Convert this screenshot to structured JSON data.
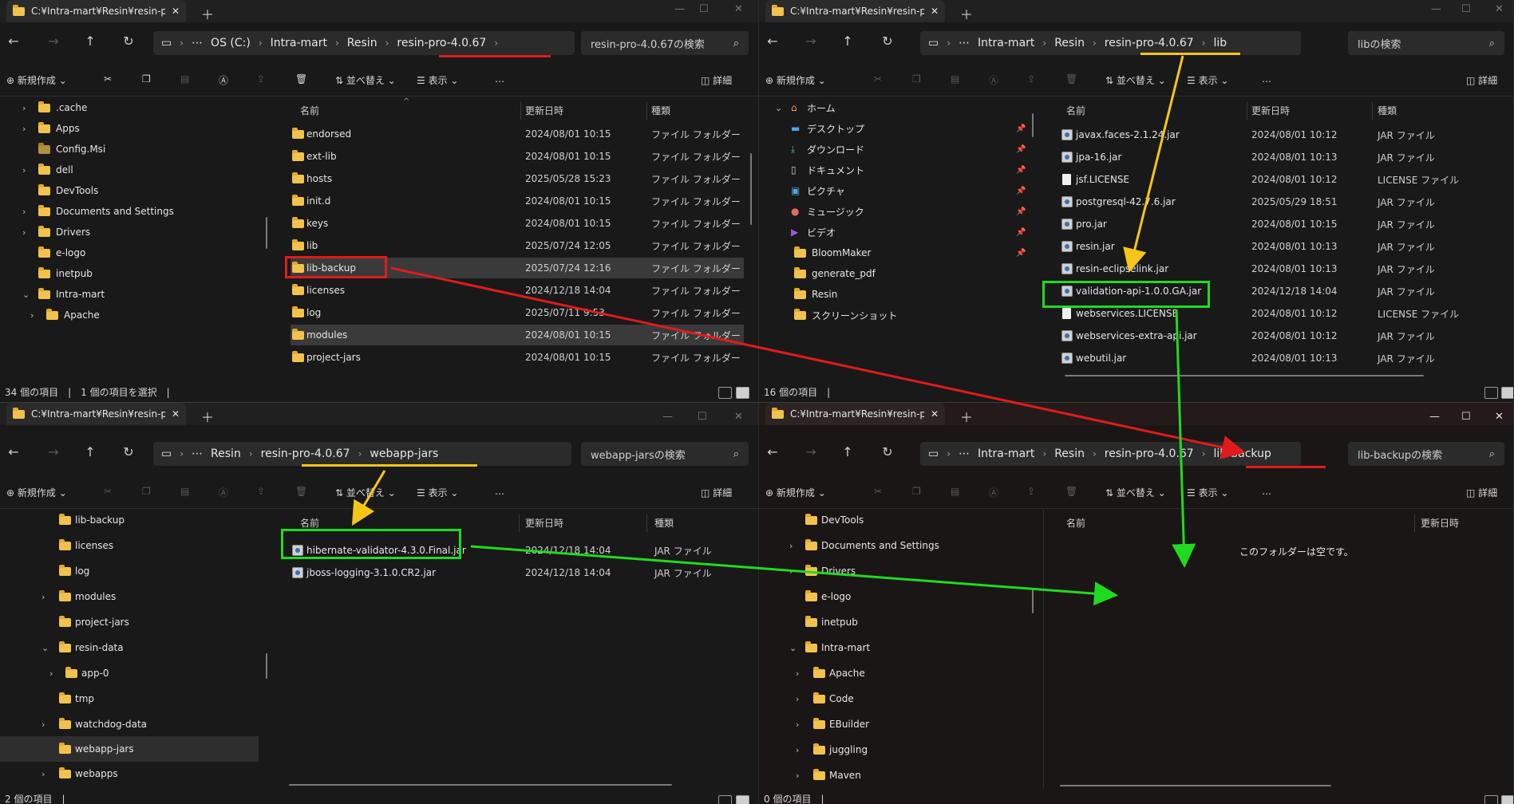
{
  "colors": {
    "red": "#e11b1b",
    "yellow": "#f5c518",
    "green": "#1fdb1f",
    "folder": "#f2c24f"
  },
  "toolbar": {
    "new_label": "新規作成",
    "sort_label": "並べ替え",
    "view_label": "表示",
    "more_label": "…",
    "details_label": "詳細"
  },
  "columns": {
    "name": "名前",
    "date": "更新日時",
    "type": "種類"
  },
  "w0": {
    "tab_title": "C:¥Intra-mart¥Resin¥resin-pro",
    "breadcrumb": [
      "OS (C:)",
      "Intra-mart",
      "Resin",
      "resin-pro-4.0.67"
    ],
    "search": "resin-pro-4.0.67の検索",
    "sidebar": [
      ".cache",
      "Apps",
      "Config.Msi",
      "dell",
      "DevTools",
      "Documents and Settings",
      "Drivers",
      "e-logo",
      "inetpub",
      "Intra-mart",
      "Apache"
    ],
    "files": [
      {
        "name": "endorsed",
        "date": "2024/08/01 10:15",
        "type": "ファイル フォルダー"
      },
      {
        "name": "ext-lib",
        "date": "2024/08/01 10:15",
        "type": "ファイル フォルダー"
      },
      {
        "name": "hosts",
        "date": "2025/05/28 15:23",
        "type": "ファイル フォルダー"
      },
      {
        "name": "init.d",
        "date": "2024/08/01 10:15",
        "type": "ファイル フォルダー"
      },
      {
        "name": "keys",
        "date": "2024/08/01 10:15",
        "type": "ファイル フォルダー"
      },
      {
        "name": "lib",
        "date": "2025/07/24 12:05",
        "type": "ファイル フォルダー"
      },
      {
        "name": "lib-backup",
        "date": "2025/07/24 12:16",
        "type": "ファイル フォルダー"
      },
      {
        "name": "licenses",
        "date": "2024/12/18 14:04",
        "type": "ファイル フォルダー"
      },
      {
        "name": "log",
        "date": "2025/07/11 9:53",
        "type": "ファイル フォルダー"
      },
      {
        "name": "modules",
        "date": "2024/08/01 10:15",
        "type": "ファイル フォルダー"
      },
      {
        "name": "project-jars",
        "date": "2024/08/01 10:15",
        "type": "ファイル フォルダー"
      }
    ],
    "status": "34 個の項目　|　1 個の項目を選択　|"
  },
  "w1": {
    "tab_title": "C:¥Intra-mart¥Resin¥resin-pro",
    "breadcrumb": [
      "Intra-mart",
      "Resin",
      "resin-pro-4.0.67",
      "lib"
    ],
    "search": "libの検索",
    "sidebar": [
      "ホーム",
      "デスクトップ",
      "ダウンロード",
      "ドキュメント",
      "ピクチャ",
      "ミュージック",
      "ビデオ",
      "BloomMaker",
      "generate_pdf",
      "Resin",
      "スクリーンショット"
    ],
    "files": [
      {
        "name": "javax.faces-2.1.24.jar",
        "date": "2024/08/01 10:12",
        "type": "JAR ファイル"
      },
      {
        "name": "jpa-16.jar",
        "date": "2024/08/01 10:13",
        "type": "JAR ファイル"
      },
      {
        "name": "jsf.LICENSE",
        "date": "2024/08/01 10:12",
        "type": "LICENSE ファイル"
      },
      {
        "name": "postgresql-42.7.6.jar",
        "date": "2025/05/29 18:51",
        "type": "JAR ファイル"
      },
      {
        "name": "pro.jar",
        "date": "2024/08/01 10:15",
        "type": "JAR ファイル"
      },
      {
        "name": "resin.jar",
        "date": "2024/08/01 10:13",
        "type": "JAR ファイル"
      },
      {
        "name": "resin-eclipselink.jar",
        "date": "2024/08/01 10:13",
        "type": "JAR ファイル"
      },
      {
        "name": "validation-api-1.0.0.GA.jar",
        "date": "2024/12/18 14:04",
        "type": "JAR ファイル"
      },
      {
        "name": "webservices.LICENSE",
        "date": "2024/08/01 10:12",
        "type": "LICENSE ファイル"
      },
      {
        "name": "webservices-extra-api.jar",
        "date": "2024/08/01 10:12",
        "type": "JAR ファイル"
      },
      {
        "name": "webutil.jar",
        "date": "2024/08/01 10:13",
        "type": "JAR ファイル"
      }
    ],
    "status": "16 個の項目　|"
  },
  "w2": {
    "tab_title": "C:¥Intra-mart¥Resin¥resin-pro",
    "breadcrumb": [
      "Resin",
      "resin-pro-4.0.67",
      "webapp-jars"
    ],
    "search": "webapp-jarsの検索",
    "sidebar": [
      "lib-backup",
      "licenses",
      "log",
      "modules",
      "project-jars",
      "resin-data",
      "app-0",
      "tmp",
      "watchdog-data",
      "webapp-jars",
      "webapps"
    ],
    "files": [
      {
        "name": "hibernate-validator-4.3.0.Final.jar",
        "date": "2024/12/18 14:04",
        "type": "JAR ファイル"
      },
      {
        "name": "jboss-logging-3.1.0.CR2.jar",
        "date": "2024/12/18 14:04",
        "type": "JAR ファイル"
      }
    ],
    "status": "2 個の項目　|"
  },
  "w3": {
    "tab_title": "C:¥Intra-mart¥Resin¥resin-pro",
    "breadcrumb": [
      "Intra-mart",
      "Resin",
      "resin-pro-4.0.67",
      "lib-backup"
    ],
    "search": "lib-backupの検索",
    "sidebar": [
      "DevTools",
      "Documents and Settings",
      "Drivers",
      "e-logo",
      "inetpub",
      "Intra-mart",
      "Apache",
      "Code",
      "EBuilder",
      "juggling",
      "Maven"
    ],
    "empty": "このフォルダーは空です。",
    "status": "0 個の項目　|"
  }
}
